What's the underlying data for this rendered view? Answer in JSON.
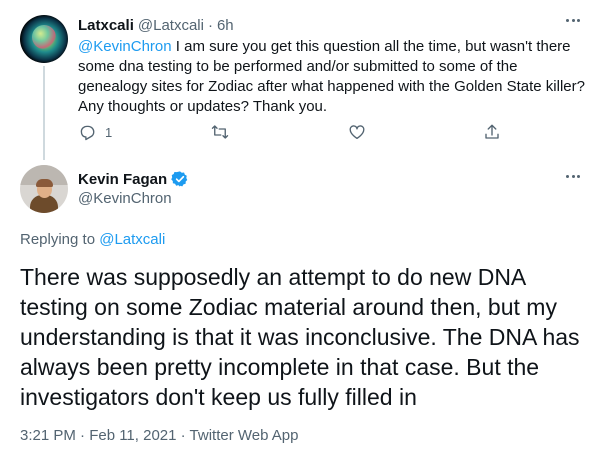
{
  "reply": {
    "name": "Latxcali",
    "handle": "@Latxcali",
    "separator": "·",
    "time": "6h",
    "mention": "@KevinChron",
    "text": " I am sure you get this question all the time, but wasn't there some dna testing to be performed and/or submitted to some of the genealogy sites for Zodiac after what happened with the Golden State killer? Any thoughts or updates? Thank you.",
    "reply_count": "1"
  },
  "tweet": {
    "name": "Kevin Fagan",
    "handle": "@KevinChron",
    "replying_prefix": "Replying to ",
    "replying_to": "@Latxcali",
    "text": "There was supposedly an attempt to do new DNA testing on some Zodiac material around then, but my understanding is that it was inconclusive. The DNA has always been pretty incomplete in that case. But the investigators don't keep us fully filled in",
    "timestamp": "3:21 PM · Feb 11, 2021 · Twitter Web App"
  },
  "colors": {
    "text": "#0f1419",
    "secondary": "#536471",
    "accent": "#1d9bf0",
    "thread_line": "#cfd9de"
  },
  "icons": [
    "reply-icon",
    "retweet-icon",
    "like-icon",
    "share-icon",
    "more-icon",
    "verified-badge-icon"
  ]
}
